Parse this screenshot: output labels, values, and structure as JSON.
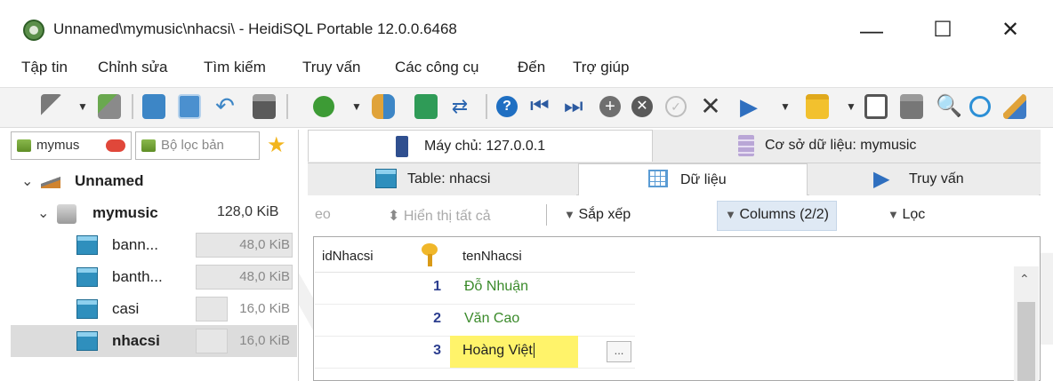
{
  "window": {
    "title": "Unnamed\\mymusic\\nhacsi\\ - HeidiSQL Portable 12.0.0.6468",
    "minimize_glyph": "—",
    "maximize_glyph": "☐",
    "close_glyph": "✕"
  },
  "menu": {
    "items": [
      "Tập tin",
      "Chỉnh sửa",
      "Tìm kiếm",
      "Truy vấn",
      "Các công cụ",
      "Đến",
      "Trợ giúp"
    ]
  },
  "toolbar": {
    "icons": [
      "connect-icon",
      "disconnect-icon",
      "copy-icon",
      "paste-icon",
      "undo-icon",
      "print-icon",
      "refresh-icon",
      "user-manager-icon",
      "export-icon",
      "sync-icon",
      "help-icon",
      "first-record-icon",
      "last-record-icon",
      "add-record-icon",
      "delete-record-icon",
      "post-icon",
      "cancel-icon",
      "run-icon",
      "open-folder-icon",
      "save-icon",
      "save-as-icon",
      "find-icon",
      "replace-icon",
      "clean-icon"
    ]
  },
  "left_panel": {
    "filter_database": "mymus",
    "filter_table_placeholder": "Bộ lọc bản",
    "tree": {
      "session": "Unnamed",
      "database": {
        "name": "mymusic",
        "size": "128,0 KiB"
      },
      "tables": [
        {
          "name": "bann...",
          "size": "48,0 KiB",
          "fill": 0.375,
          "selected": false
        },
        {
          "name": "banth...",
          "size": "48,0 KiB",
          "fill": 0.375,
          "selected": false
        },
        {
          "name": "casi",
          "size": "16,0 KiB",
          "fill": 0.125,
          "selected": false
        },
        {
          "name": "nhacsi",
          "size": "16,0 KiB",
          "fill": 0.125,
          "selected": true
        }
      ]
    }
  },
  "tabs_row1": {
    "host": "Máy chủ: 127.0.0.1",
    "database": "Cơ sở dữ liệu: mymusic"
  },
  "tabs_row2": {
    "table": "Table: nhacsi",
    "data": "Dữ liệu",
    "query": "Truy vấn"
  },
  "data_filter_bar": {
    "left_fragment": "eo",
    "show_all": "Hiển thị tất cả",
    "sort": "Sắp xếp",
    "columns": "Columns (2/2)",
    "filter": "Lọc"
  },
  "grid": {
    "columns": [
      "idNhacsi",
      "tenNhacsi"
    ],
    "rows": [
      {
        "id": "1",
        "name": "Đỗ Nhuận"
      },
      {
        "id": "2",
        "name": "Văn Cao"
      },
      {
        "id": "3",
        "name": "Hoàng Việt"
      }
    ],
    "ellipsis": "..."
  },
  "colors": {
    "accent_highlight": "#fff36a",
    "name_text": "#3a8a2a",
    "row_number": "#2c3e8f",
    "selected_row": "#dcdcdc"
  }
}
